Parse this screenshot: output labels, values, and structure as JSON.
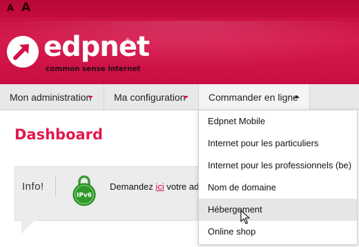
{
  "font_controls": {
    "small": "A",
    "large": "A"
  },
  "brand": {
    "name": "edpnet",
    "registered": "®",
    "tagline": "common sense internet",
    "accent": "#d01346"
  },
  "nav": {
    "items": [
      {
        "label": "Mon administration",
        "caret": "chevron-down-icon"
      },
      {
        "label": "Ma configuration",
        "caret": "chevron-down-icon"
      },
      {
        "label": "Commander en ligne",
        "caret": "chevron-up-icon"
      }
    ]
  },
  "dashboard": {
    "title": "Dashboard"
  },
  "info": {
    "label": "Info!",
    "badge_text": "IPv6",
    "text_before": "Demandez ",
    "link": "ici",
    "text_after": " votre adr"
  },
  "dropdown": {
    "items": [
      {
        "label": "Edpnet Mobile"
      },
      {
        "label": "Internet pour les particuliers"
      },
      {
        "label": "Internet pour les professionnels (be)"
      },
      {
        "label": "Nom de domaine"
      },
      {
        "label": "Hébergement"
      },
      {
        "label": "Online shop"
      }
    ],
    "hovered_index": 4
  }
}
